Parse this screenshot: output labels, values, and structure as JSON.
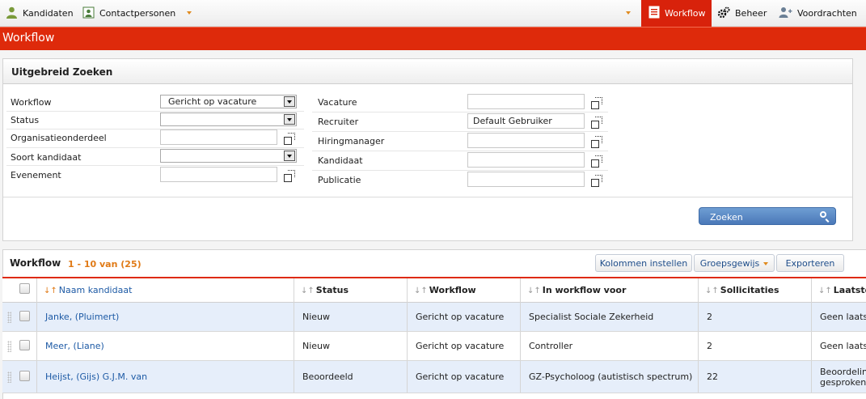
{
  "topnav": {
    "left": [
      {
        "label": "Kandidaten",
        "icon": "person-icon"
      },
      {
        "label": "Contactpersonen",
        "icon": "contact-card-icon"
      }
    ],
    "right": [
      {
        "label": "Workflow",
        "icon": "workflow-list-icon",
        "active": true
      },
      {
        "label": "Beheer",
        "icon": "gears-icon"
      },
      {
        "label": "Voordrachten",
        "icon": "person-add-icon"
      }
    ]
  },
  "page": {
    "title": "Workflow"
  },
  "search": {
    "title": "Uitgebreid Zoeken",
    "left_fields": [
      {
        "label": "Workflow",
        "type": "select",
        "value": "Gericht op vacature"
      },
      {
        "label": "Status",
        "type": "select",
        "value": ""
      },
      {
        "label": "Organisatieonderdeel",
        "type": "picker",
        "value": ""
      },
      {
        "label": "Soort kandidaat",
        "type": "select",
        "value": ""
      },
      {
        "label": "Evenement",
        "type": "picker",
        "value": ""
      }
    ],
    "right_fields": [
      {
        "label": "Vacature",
        "type": "picker",
        "value": ""
      },
      {
        "label": "Recruiter",
        "type": "picker",
        "value": "Default Gebruiker"
      },
      {
        "label": "Hiringmanager",
        "type": "picker",
        "value": ""
      },
      {
        "label": "Kandidaat",
        "type": "picker",
        "value": ""
      },
      {
        "label": "Publicatie",
        "type": "picker",
        "value": ""
      }
    ],
    "button": "Zoeken"
  },
  "results": {
    "title": "Workflow",
    "count": "1 - 10 van (25)",
    "buttons": {
      "columns": "Kolommen instellen",
      "group": "Groepsgewijs",
      "export": "Exporteren"
    },
    "columns": [
      "Naam kandidaat",
      "Status",
      "Workflow",
      "In workflow voor",
      "Sollicitaties",
      "Laatste"
    ],
    "rows": [
      {
        "name": "Janke, (Pluimert)",
        "status": "Nieuw",
        "workflow": "Gericht op vacature",
        "for": "Specialist Sociale Zekerheid",
        "applications": "2",
        "last": "Geen laatste"
      },
      {
        "name": "Meer, (Liane)",
        "status": "Nieuw",
        "workflow": "Gericht op vacature",
        "for": "Controller",
        "applications": "2",
        "last": "Geen laatste"
      },
      {
        "name": "Heijst, (Gijs) G.J.M. van",
        "status": "Beoordeeld",
        "workflow": "Gericht op vacature",
        "for": "GZ-Psycholoog (autistisch spectrum)",
        "applications": "22",
        "last": "Beoordeling gesproken"
      }
    ]
  }
}
